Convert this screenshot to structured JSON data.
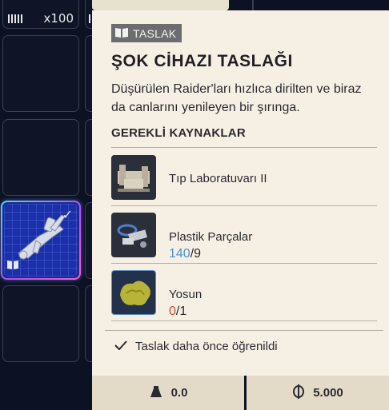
{
  "inventory": {
    "top_slot_count": "x100",
    "selected_slot_icons": [
      "checkmark-icon",
      "blueprint-book-icon"
    ]
  },
  "detail": {
    "badge_label": "TASLAK",
    "title": "ŞOK CİHAZI TASLAĞI",
    "description": "Düşürülen Raider'ları hızlıca dirilten ve biraz da canlarını yenileyen bir şırınga.",
    "section_title": "GEREKLİ KAYNAKLAR",
    "resources": [
      {
        "name": "Tıp Laboratuvarı II",
        "have": "",
        "sep": "",
        "need": "",
        "icon": "medical-lab-icon"
      },
      {
        "name": "Plastik Parçalar",
        "have": "140",
        "sep": "/",
        "need": "9",
        "have_color": "#4b8ed1",
        "icon": "plastic-parts-icon"
      },
      {
        "name": "Yosun",
        "have": "0",
        "sep": "/",
        "need": "1",
        "have_color": "#d9482e",
        "icon": "moss-icon"
      }
    ],
    "learned_text": "Taslak daha önce öğrenildi",
    "footer": {
      "weight": "0.0",
      "price": "5.000"
    }
  },
  "colors": {
    "panel_bg": "#f6f0e4",
    "page_bg": "#0c1224",
    "have_ok": "#4b8ed1",
    "have_missing": "#d9482e",
    "selected_slot": "#1a2fa8"
  }
}
